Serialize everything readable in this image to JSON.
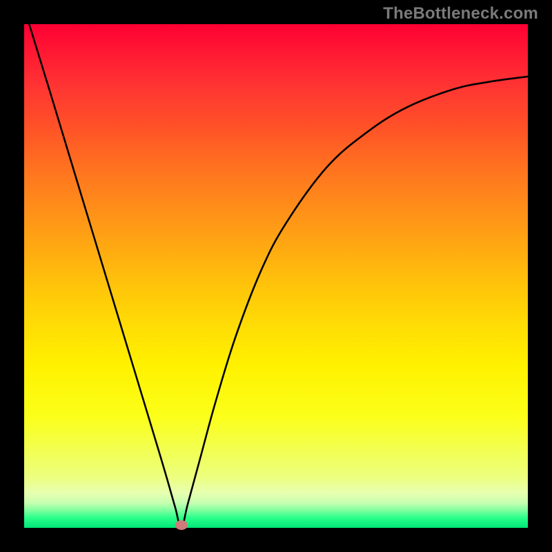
{
  "watermark": "TheBottleneck.com",
  "chart_data": {
    "type": "line",
    "title": "",
    "xlabel": "",
    "ylabel": "",
    "xlim": [
      0,
      1
    ],
    "ylim": [
      0,
      1
    ],
    "minimum_x": 0.312,
    "series": [
      {
        "name": "curve",
        "x": [
          0.01,
          0.05,
          0.1,
          0.15,
          0.2,
          0.25,
          0.28,
          0.3,
          0.312,
          0.325,
          0.35,
          0.38,
          0.42,
          0.47,
          0.52,
          0.6,
          0.68,
          0.76,
          0.85,
          0.92,
          1.0
        ],
        "y": [
          1.0,
          0.87,
          0.705,
          0.54,
          0.375,
          0.21,
          0.11,
          0.04,
          0.0,
          0.048,
          0.14,
          0.25,
          0.38,
          0.51,
          0.605,
          0.715,
          0.785,
          0.835,
          0.87,
          0.885,
          0.896
        ]
      }
    ],
    "marker": {
      "x": 0.312,
      "y": 0.0,
      "color": "#d07a7a"
    },
    "background_gradient": {
      "top": "#ff0033",
      "bottom": "#00e676"
    }
  }
}
